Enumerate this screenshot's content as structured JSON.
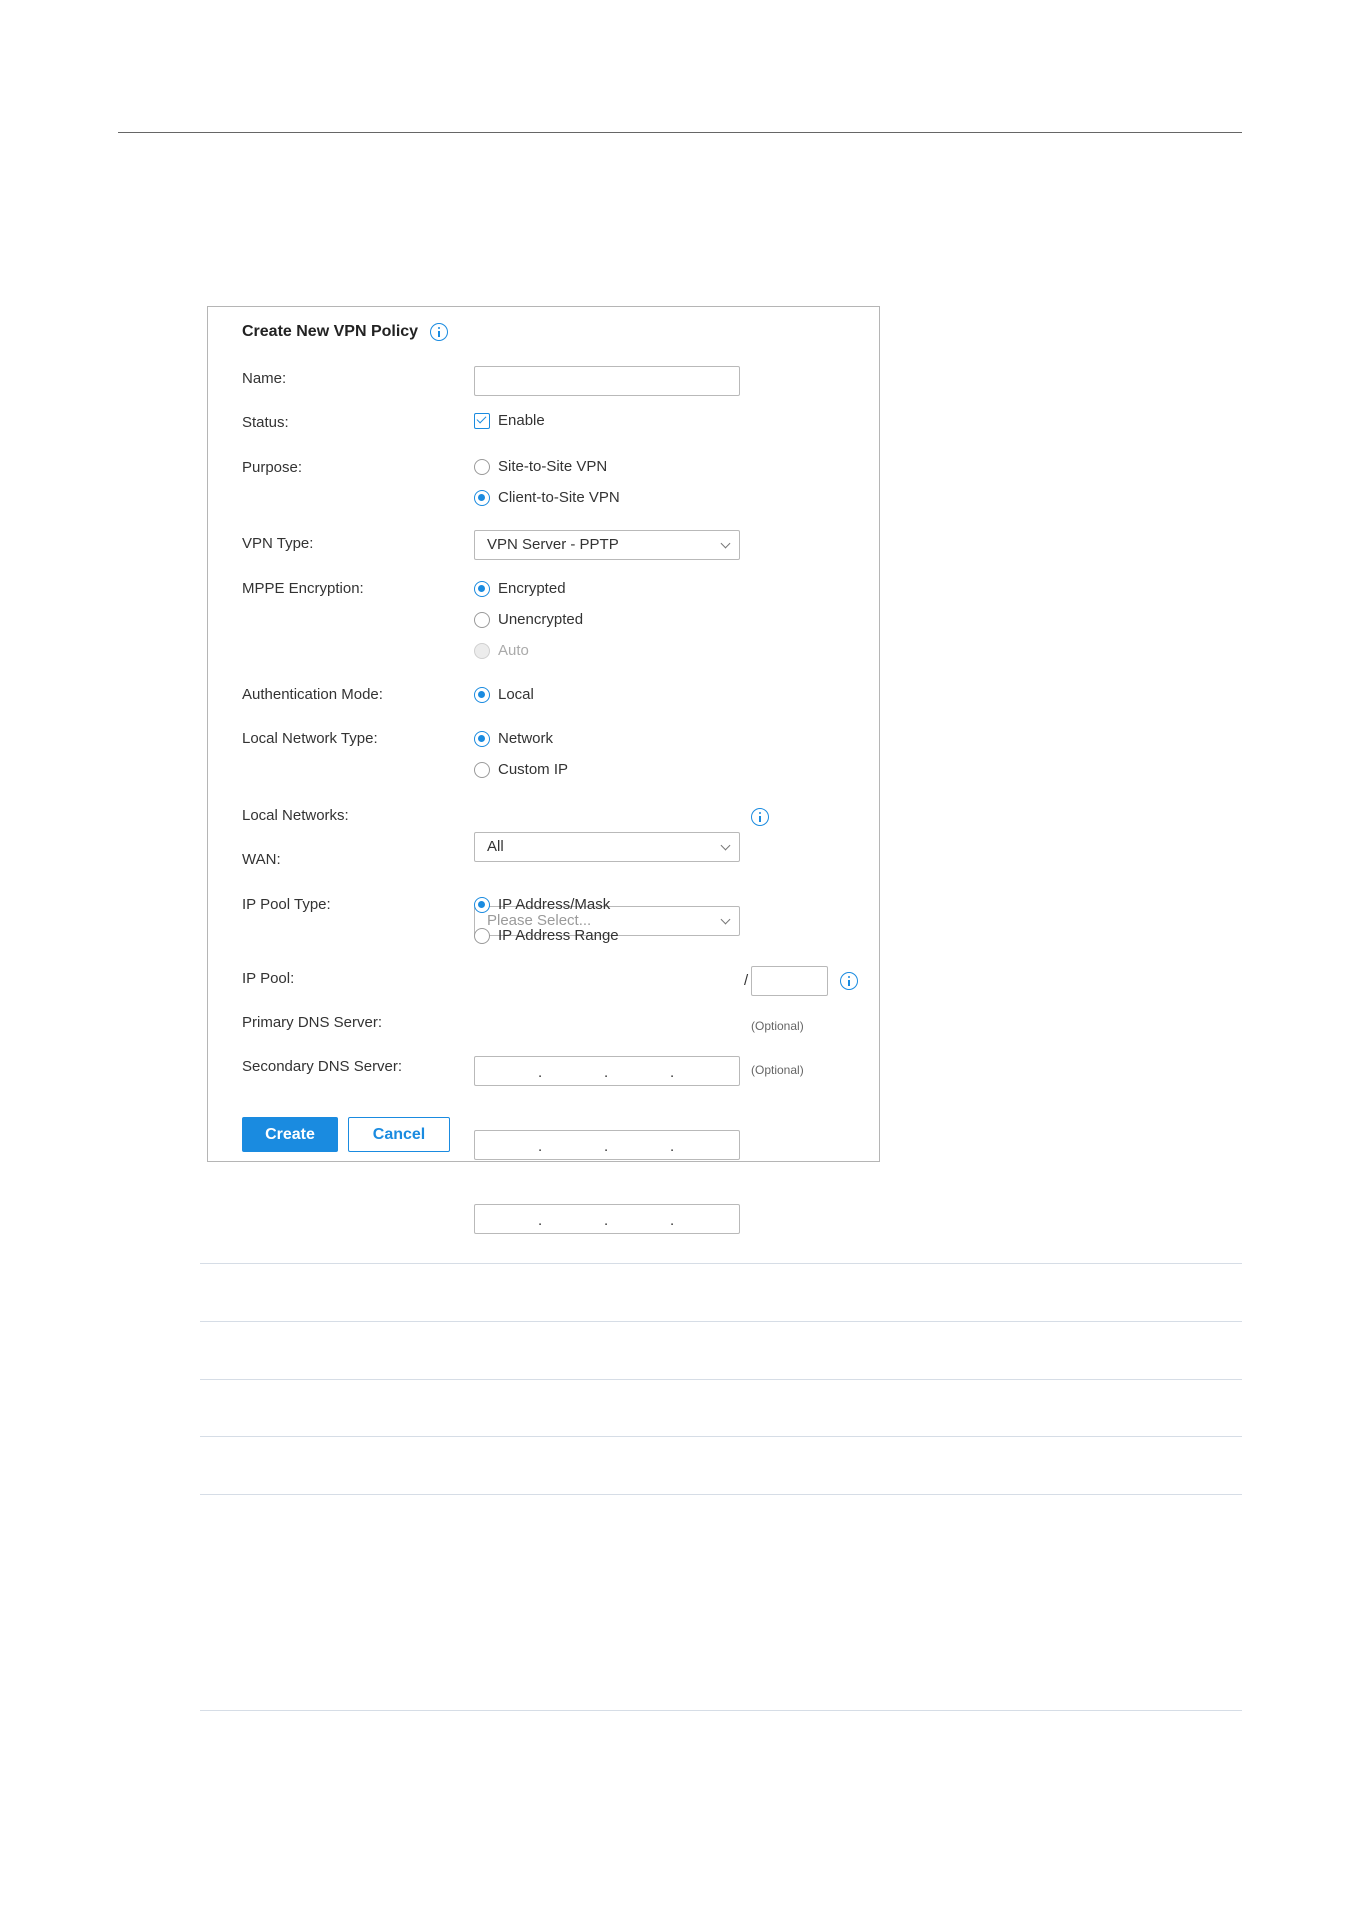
{
  "form": {
    "title": "Create New VPN Policy",
    "name": {
      "label": "Name:",
      "value": ""
    },
    "status": {
      "label": "Status:",
      "option": "Enable",
      "checked": true
    },
    "purpose": {
      "label": "Purpose:",
      "options": [
        {
          "label": "Site-to-Site VPN",
          "selected": false
        },
        {
          "label": "Client-to-Site VPN",
          "selected": true
        }
      ]
    },
    "vpn_type": {
      "label": "VPN Type:",
      "value": "VPN Server - PPTP"
    },
    "mppe": {
      "label": "MPPE Encryption:",
      "options": [
        {
          "label": "Encrypted",
          "selected": true
        },
        {
          "label": "Unencrypted",
          "selected": false
        },
        {
          "label": "Auto",
          "selected": false,
          "disabled": true
        }
      ]
    },
    "auth_mode": {
      "label": "Authentication Mode:",
      "option": "Local",
      "selected": true
    },
    "local_network_type": {
      "label": "Local Network Type:",
      "options": [
        {
          "label": "Network",
          "selected": true
        },
        {
          "label": "Custom IP",
          "selected": false
        }
      ]
    },
    "local_networks": {
      "label": "Local Networks:",
      "value": "All"
    },
    "wan": {
      "label": "WAN:",
      "placeholder": "Please Select..."
    },
    "ip_pool_type": {
      "label": "IP Pool Type:",
      "options": [
        {
          "label": "IP Address/Mask",
          "selected": true
        },
        {
          "label": "IP Address Range",
          "selected": false
        }
      ]
    },
    "ip_pool": {
      "label": "IP Pool:",
      "separator": "/"
    },
    "primary_dns": {
      "label": "Primary DNS Server:",
      "hint": "(Optional)"
    },
    "secondary_dns": {
      "label": "Secondary DNS Server:",
      "hint": "(Optional)"
    },
    "ip_dot": ".",
    "create_label": "Create",
    "cancel_label": "Cancel"
  },
  "colors": {
    "accent": "#1a8be0",
    "border": "#b9b9b9",
    "disabled_text": "#aaaaaa"
  }
}
